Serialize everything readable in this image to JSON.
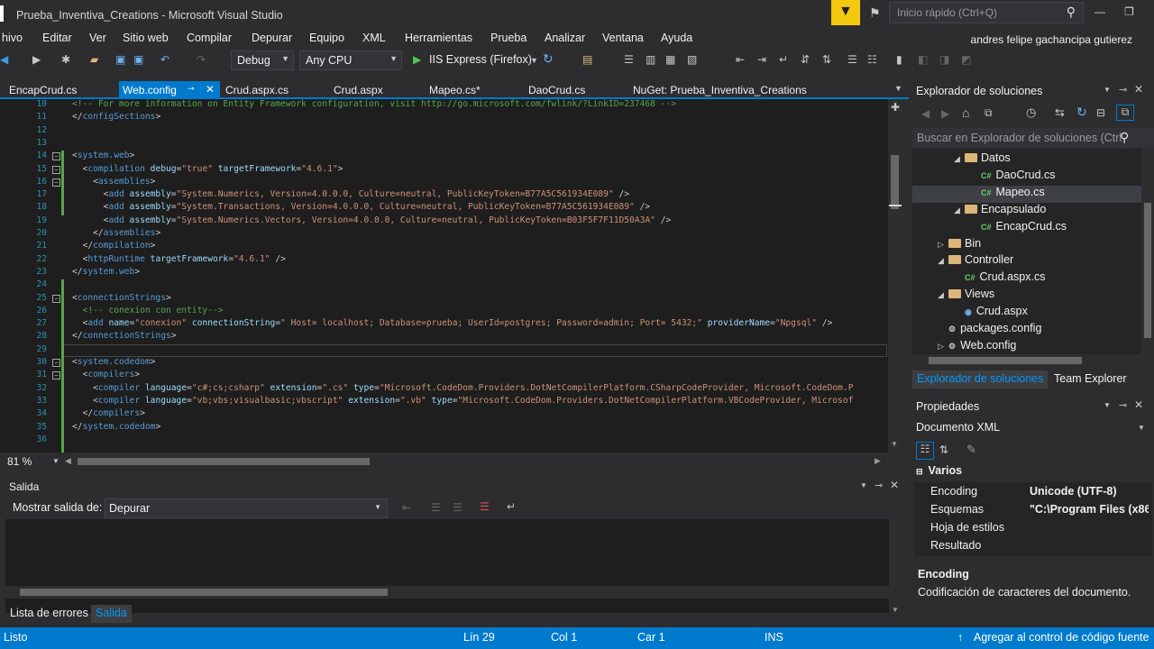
{
  "window": {
    "title": "Prueba_Inventiva_Creations - Microsoft Visual Studio",
    "quick_launch_placeholder": "Inicio rápido (Ctrl+Q)"
  },
  "menu": {
    "items": [
      "hivo",
      "Editar",
      "Ver",
      "Sitio web",
      "Compilar",
      "Depurar",
      "Equipo",
      "XML",
      "Herramientas",
      "Prueba",
      "Analizar",
      "Ventana",
      "Ayuda"
    ],
    "user": "andres felipe gachancipa gutierez"
  },
  "toolbar": {
    "config": "Debug",
    "platform": "Any CPU",
    "run_target": "IIS Express (Firefox)"
  },
  "doc_tabs": [
    {
      "label": "EncapCrud.cs"
    },
    {
      "label": "Web.config"
    },
    {
      "label": "Crud.aspx.cs"
    },
    {
      "label": "Crud.aspx"
    },
    {
      "label": "Mapeo.cs*"
    },
    {
      "label": "DaoCrud.cs"
    },
    {
      "label": "NuGet: Prueba_Inventiva_Creations"
    }
  ],
  "editor": {
    "zoom": "81 %",
    "lines": [
      {
        "n": "10",
        "code": "<!-- For more information on Entity Framework configuration, visit http://go.microsoft.com/fwlink/?LinkID=237468 -->"
      },
      {
        "n": "11",
        "code": "</configSections>"
      },
      {
        "n": "12",
        "code": ""
      },
      {
        "n": "13",
        "code": ""
      },
      {
        "n": "14",
        "code": "<system.web>"
      },
      {
        "n": "15",
        "code": "  <compilation debug=\"true\" targetFramework=\"4.6.1\">"
      },
      {
        "n": "16",
        "code": "    <assemblies>"
      },
      {
        "n": "17",
        "code": "      <add assembly=\"System.Numerics, Version=4.0.0.0, Culture=neutral, PublicKeyToken=B77A5C561934E089\" />"
      },
      {
        "n": "18",
        "code": "      <add assembly=\"System.Transactions, Version=4.0.0.0, Culture=neutral, PublicKeyToken=B77A5C561934E089\" />"
      },
      {
        "n": "19",
        "code": "      <add assembly=\"System.Numerics.Vectors, Version=4.0.0.0, Culture=neutral, PublicKeyToken=B03F5F7F11D50A3A\" />"
      },
      {
        "n": "20",
        "code": "    </assemblies>"
      },
      {
        "n": "21",
        "code": "  </compilation>"
      },
      {
        "n": "22",
        "code": "  <httpRuntime targetFramework=\"4.6.1\" />"
      },
      {
        "n": "23",
        "code": "</system.web>"
      },
      {
        "n": "24",
        "code": ""
      },
      {
        "n": "25",
        "code": "<connectionStrings>"
      },
      {
        "n": "26",
        "code": "  <!-- conexion con entity-->"
      },
      {
        "n": "27",
        "code": "  <add name=\"conexion\" connectionString=\" Host= localhost; Database=prueba; UserId=postgres; Password=admin; Port= 5432;\" providerName=\"Npgsql\" />"
      },
      {
        "n": "28",
        "code": "</connectionStrings>"
      },
      {
        "n": "29",
        "code": ""
      },
      {
        "n": "30",
        "code": "<system.codedom>"
      },
      {
        "n": "31",
        "code": "  <compilers>"
      },
      {
        "n": "32",
        "code": "    <compiler language=\"c#;cs;csharp\" extension=\".cs\" type=\"Microsoft.CodeDom.Providers.DotNetCompilerPlatform.CSharpCodeProvider, Microsoft.CodeDom.P"
      },
      {
        "n": "33",
        "code": "    <compiler language=\"vb;vbs;visualbasic;vbscript\" extension=\".vb\" type=\"Microsoft.CodeDom.Providers.DotNetCompilerPlatform.VBCodeProvider, Microsof"
      },
      {
        "n": "34",
        "code": "  </compilers>"
      },
      {
        "n": "35",
        "code": "</system.codedom>"
      },
      {
        "n": "36",
        "code": ""
      }
    ]
  },
  "output": {
    "title": "Salida",
    "show_label": "Mostrar salida de:",
    "source": "Depurar"
  },
  "bottom_tabs": [
    "Lista de errores",
    "Salida"
  ],
  "solution_explorer": {
    "title": "Explorador de soluciones",
    "search_placeholder": "Buscar en Explorador de soluciones (Ctrl",
    "nodes": [
      {
        "label": "Datos",
        "kind": "folder",
        "state": "open",
        "indent": 1
      },
      {
        "label": "DaoCrud.cs",
        "kind": "cs",
        "indent": 2
      },
      {
        "label": "Mapeo.cs",
        "kind": "cs",
        "indent": 2,
        "selected": true
      },
      {
        "label": "Encapsulado",
        "kind": "folder",
        "state": "open",
        "indent": 1
      },
      {
        "label": "EncapCrud.cs",
        "kind": "cs",
        "indent": 2
      },
      {
        "label": "Bin",
        "kind": "folder",
        "state": "closed",
        "indent": 0
      },
      {
        "label": "Controller",
        "kind": "folder",
        "state": "open",
        "indent": 0
      },
      {
        "label": "Crud.aspx.cs",
        "kind": "cs",
        "indent": 1
      },
      {
        "label": "Views",
        "kind": "folder",
        "state": "open",
        "indent": 0
      },
      {
        "label": "Crud.aspx",
        "kind": "web",
        "indent": 1
      },
      {
        "label": "packages.config",
        "kind": "config",
        "indent": 0
      },
      {
        "label": "Web.config",
        "kind": "config",
        "state": "closed",
        "indent": 0
      }
    ],
    "tabs": [
      "Explorador de soluciones",
      "Team Explorer"
    ]
  },
  "properties": {
    "title": "Propiedades",
    "object": "Documento XML",
    "category": "Varios",
    "rows": [
      {
        "key": "Encoding",
        "value": "Unicode (UTF-8)"
      },
      {
        "key": "Esquemas",
        "value": "\"C:\\Program Files (x86)"
      },
      {
        "key": "Hoja de estilos",
        "value": ""
      },
      {
        "key": "Resultado",
        "value": ""
      }
    ],
    "desc_title": "Encoding",
    "desc": "Codificación de caracteres del documento."
  },
  "status": {
    "left": "Listo",
    "line": "Lín 29",
    "col": "Col 1",
    "car": "Car 1",
    "mode": "INS",
    "source_control": "Agregar al control de código fuente"
  }
}
